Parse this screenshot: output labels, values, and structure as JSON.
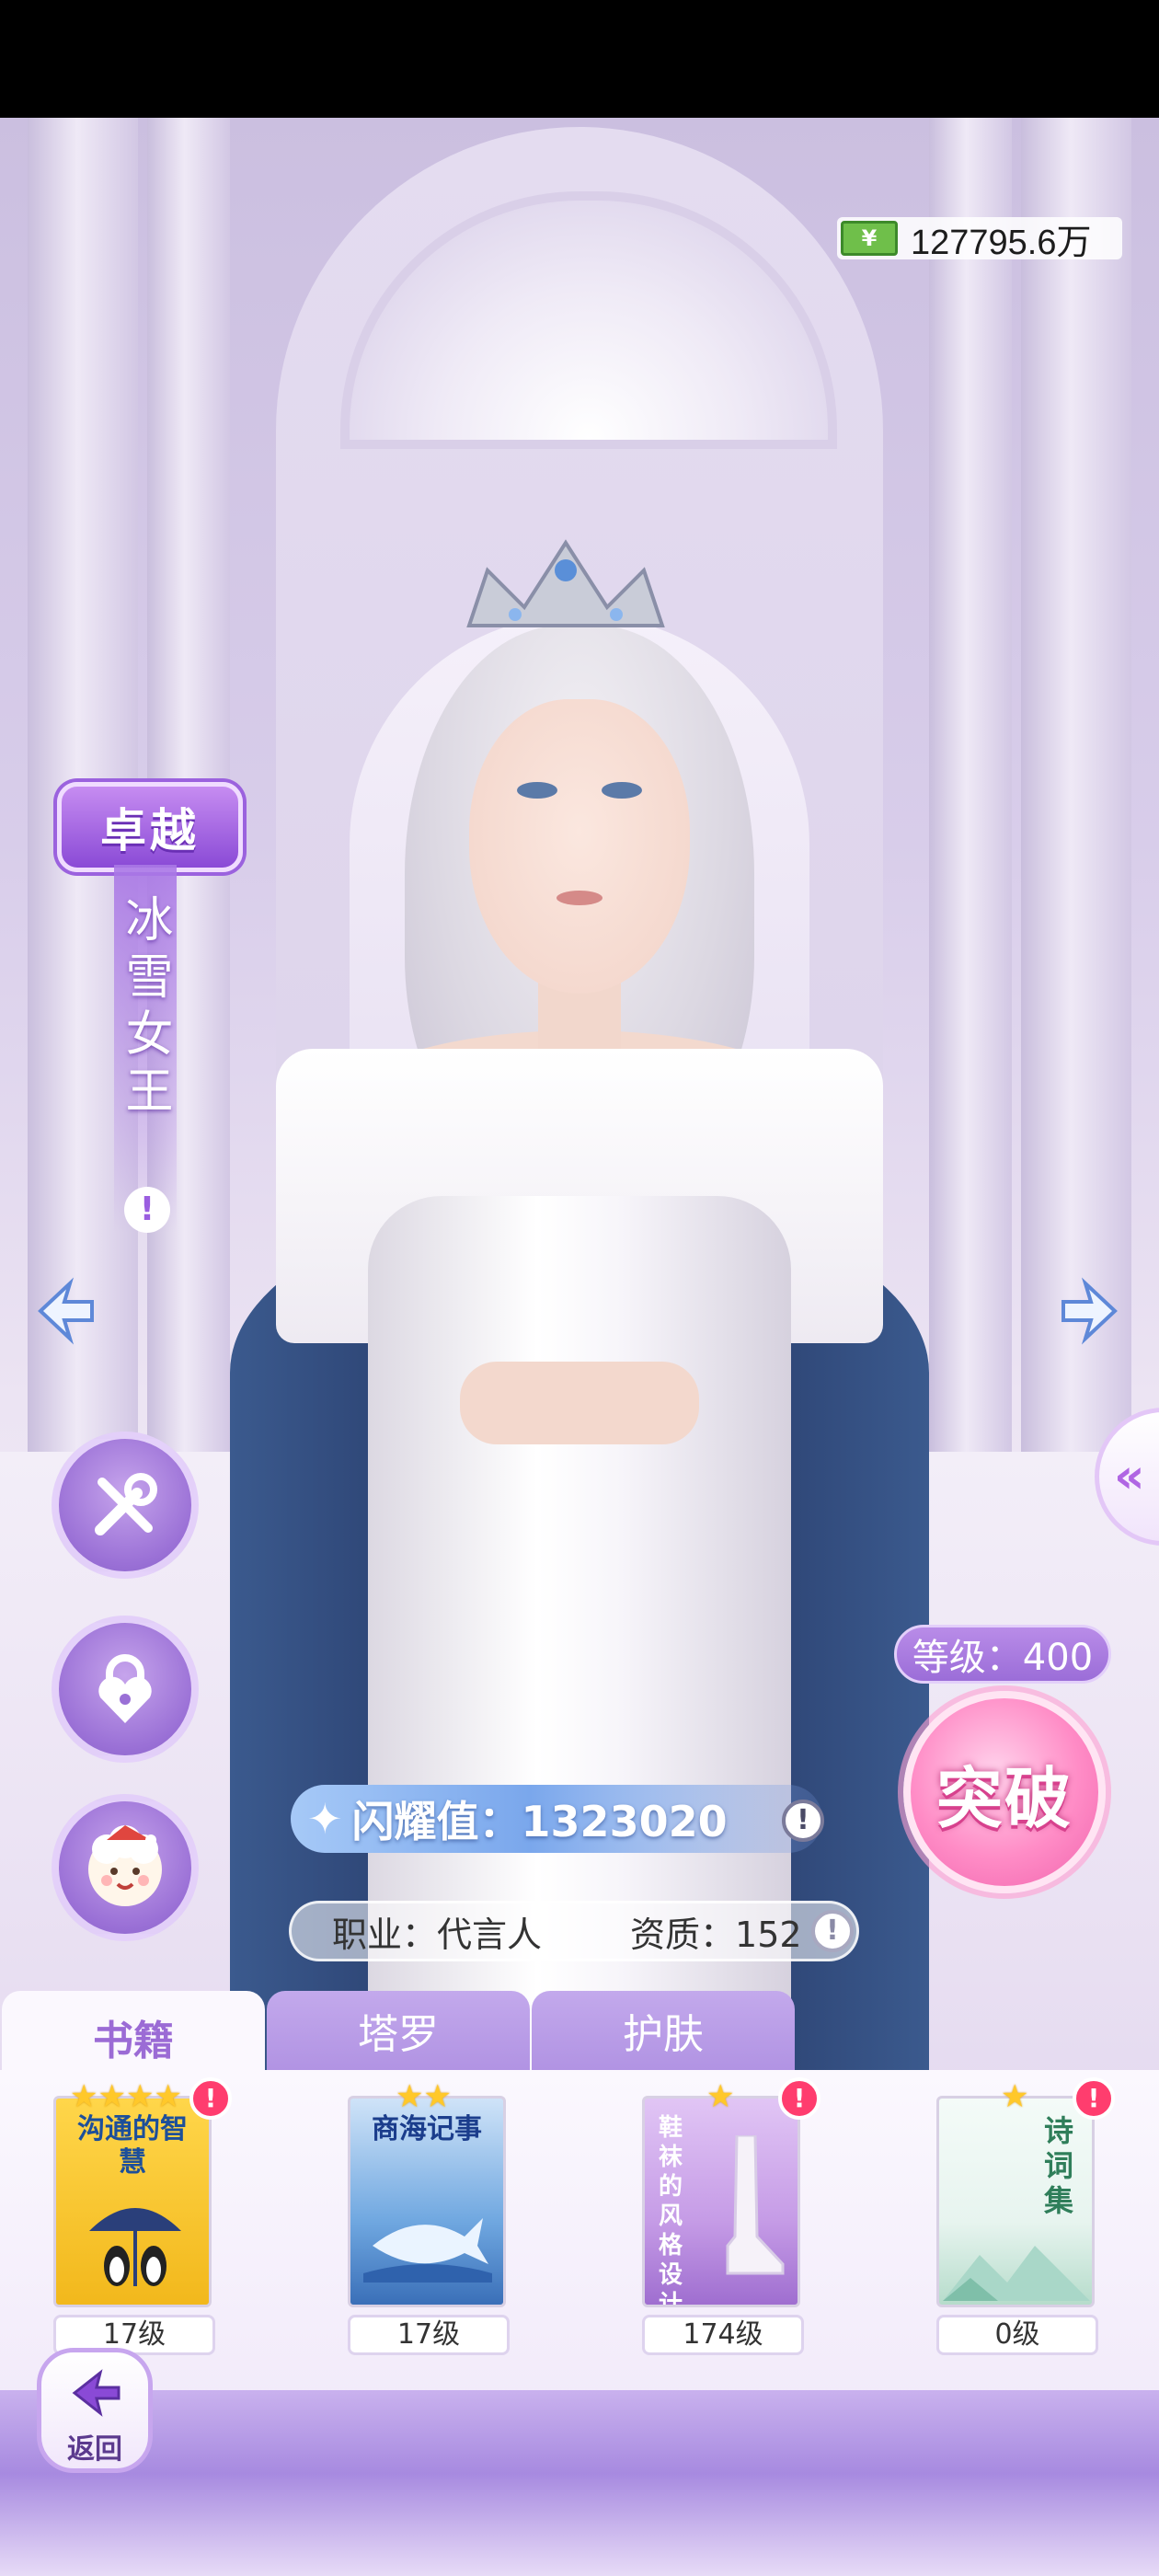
{
  "currency": {
    "icon": "cash-icon",
    "value": "127795.6万"
  },
  "character": {
    "rank": "卓越",
    "name": "冰雪女王",
    "info_mark": "!"
  },
  "level": {
    "label": "等级：400"
  },
  "breakthrough": {
    "label": "突破"
  },
  "glory": {
    "label": "闪耀值：1323020",
    "info_mark": "!"
  },
  "profile": {
    "job": "职业：代言人",
    "aptitude": "资质：152",
    "info_mark": "!"
  },
  "tabs": [
    {
      "label": "书籍",
      "active": true
    },
    {
      "label": "塔罗",
      "active": false
    },
    {
      "label": "护肤",
      "active": false
    }
  ],
  "items": [
    {
      "title": "沟通的智慧",
      "stars": 4,
      "level": "17级",
      "has_alert": true,
      "cover": "#f5c42b",
      "title_color": "#1d4f9a"
    },
    {
      "title": "商海记事",
      "stars": 2,
      "level": "17级",
      "has_alert": false,
      "cover": "#6fa7e0",
      "title_color": "#1b3d8c"
    },
    {
      "title": "鞋袜的风格设计",
      "stars": 1,
      "level": "174级",
      "has_alert": true,
      "cover": "#c59be6",
      "title_color": "#ffffff"
    },
    {
      "title": "诗词集",
      "stars": 1,
      "level": "0级",
      "has_alert": true,
      "cover": "#e7f4ef",
      "title_color": "#2f7e5a"
    }
  ],
  "back": {
    "label": "返回"
  },
  "colors": {
    "accent": "#9b6bd5",
    "alert": "#ff3d6e",
    "star": "#ffc82a",
    "break": "#f064ad"
  }
}
